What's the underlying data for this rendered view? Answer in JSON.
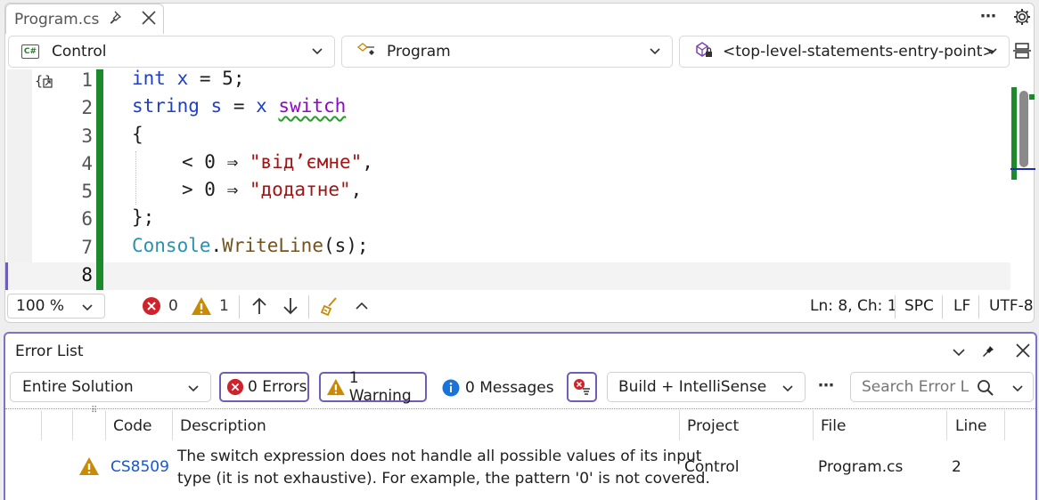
{
  "editor": {
    "tab_title": "Program.cs",
    "nav_project": "Control",
    "nav_class": "Program",
    "nav_member": "<top-level-statements-entry-point>",
    "line_numbers": [
      "1",
      "2",
      "3",
      "4",
      "5",
      "6",
      "7",
      "8"
    ],
    "lines": {
      "l1_kw": "int",
      "l1_id": "x",
      "l1_rest": " = 5;",
      "l2_kw": "string",
      "l2_id": "s",
      "l2_mid": " = ",
      "l2_x": "x",
      "l2_sw": "switch",
      "l3": "{",
      "l4_pre": "< 0 ⇒ ",
      "l4_str": "\"від’ємне\"",
      "l4_post": ",",
      "l5_pre": "> 0 ⇒ ",
      "l5_str": "\"додатне\"",
      "l5_post": ",",
      "l6": "};",
      "l7_cls": "Console",
      "l7_dot": ".",
      "l7_meth": "WriteLine",
      "l7_rest": "(s);"
    }
  },
  "statusbar": {
    "zoom": "100 %",
    "error_count": "0",
    "warning_count": "1",
    "position": "Ln: 8, Ch: 1",
    "whitespace": "SPC",
    "line_ending": "LF",
    "encoding": "UTF-8"
  },
  "error_list": {
    "title": "Error List",
    "scope": "Entire Solution",
    "errors_label": "0 Errors",
    "warnings_label": "1 Warning",
    "messages_label": "0 Messages",
    "source": "Build + IntelliSense",
    "search_placeholder": "Search Error Li",
    "columns": [
      "Code",
      "Description",
      "Project",
      "File",
      "Line"
    ],
    "rows": [
      {
        "code": "CS8509",
        "description_1": "The switch expression does not handle all possible values of its input",
        "description_2": "type (it is not exhaustive). For example, the pattern '0' is not covered.",
        "project": "Control",
        "file": "Program.cs",
        "line": "2"
      }
    ]
  },
  "colors": {
    "accent": "#6f5db8",
    "keyword": "#1f3fc8",
    "string": "#a31515",
    "type": "#2b91af",
    "method": "#74531f",
    "change_bar": "#1c8a2a",
    "error": "#d0222b",
    "warning": "#c98a06",
    "info": "#1a73d9"
  }
}
